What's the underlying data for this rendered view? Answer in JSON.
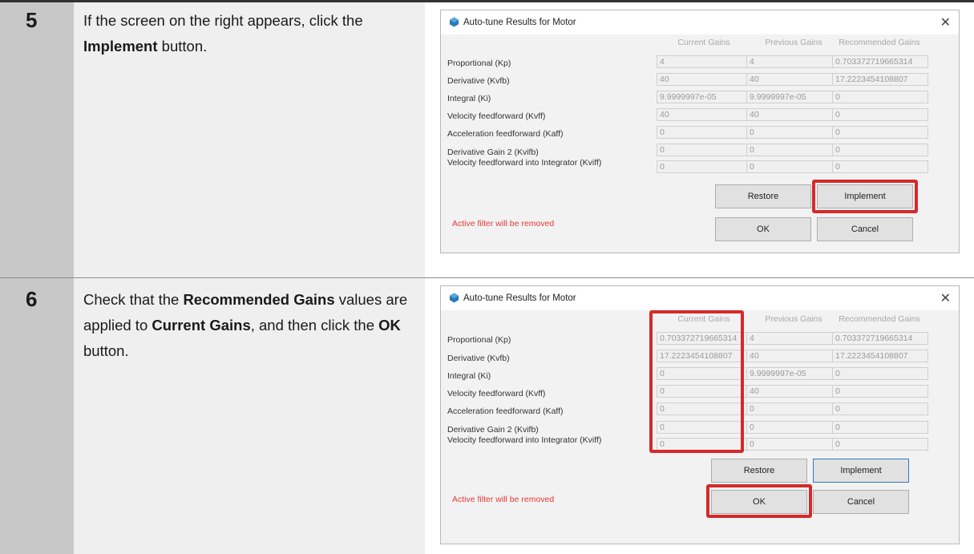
{
  "steps": [
    {
      "number": "5",
      "text_before": "If the screen on the right appears, click the ",
      "bold": "Implement",
      "text_after": " button."
    },
    {
      "number": "6",
      "text_1": "Check that the ",
      "bold_1": "Recommended Gains",
      "text_2": " values are applied to ",
      "bold_2": "Current Gains",
      "text_3": ", and then click the ",
      "bold_3": "OK",
      "text_4": " button."
    }
  ],
  "dialog": {
    "title": "Auto-tune Results for Motor",
    "close_glyph": "✕",
    "columns": [
      "Current Gains",
      "Previous Gains",
      "Recommended Gains"
    ],
    "rows": [
      "Proportional (Kp)",
      "Derivative (Kvfb)",
      "Integral (Ki)",
      "Velocity feedforward (Kvff)",
      "Acceleration feedforward (Kaff)",
      "Derivative Gain 2 (Kvifb)",
      "Velocity feedforward into Integrator (Kviff)"
    ],
    "buttons": {
      "restore": "Restore",
      "implement": "Implement",
      "ok": "OK",
      "cancel": "Cancel"
    },
    "warning": "Active filter will be removed",
    "warning_color": "#e53935",
    "highlight_color": "#d42a2a"
  },
  "dialog1_values": {
    "current": [
      "4",
      "40",
      "9.9999997e-05",
      "40",
      "0",
      "0",
      "0"
    ],
    "previous": [
      "4",
      "40",
      "9.9999997e-05",
      "40",
      "0",
      "0",
      "0"
    ],
    "recommended": [
      "0.703372719665314",
      "17.2223454108807",
      "0",
      "0",
      "0",
      "0",
      "0"
    ]
  },
  "dialog2_values": {
    "current": [
      "0.703372719665314",
      "17.2223454108807",
      "0",
      "0",
      "0",
      "0",
      "0"
    ],
    "previous": [
      "4",
      "40",
      "9.9999997e-05",
      "40",
      "0",
      "0",
      "0"
    ],
    "recommended": [
      "0.703372719665314",
      "17.2223454108807",
      "0",
      "0",
      "0",
      "0",
      "0"
    ]
  }
}
